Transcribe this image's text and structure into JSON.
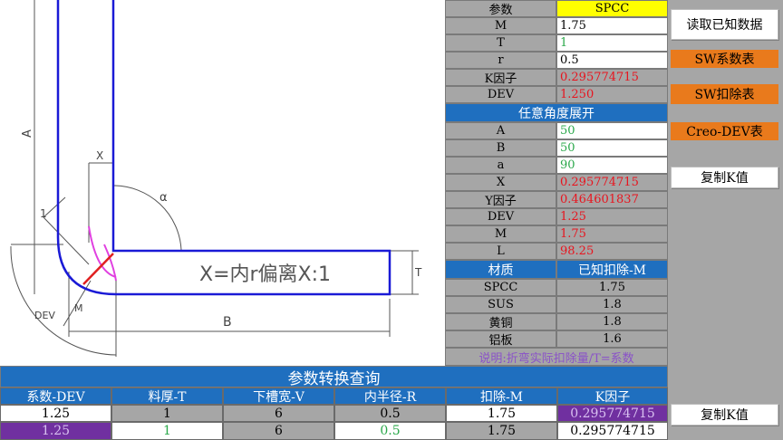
{
  "diagram": {
    "label_a": "A",
    "label_b": "B",
    "label_x": "X",
    "label_t": "T",
    "label_one": "1",
    "label_alpha": "α",
    "label_dev": "DEV",
    "label_m": "M",
    "formula": "X=内r偏离X:1"
  },
  "params": {
    "header_label": "参数",
    "header_value": "SPCC",
    "rows": [
      {
        "label": "M",
        "value": "1.75"
      },
      {
        "label": "T",
        "value": "1"
      },
      {
        "label": "r",
        "value": "0.5"
      },
      {
        "label": "K因子",
        "value": "0.295774715"
      },
      {
        "label": "DEV",
        "value": "1.250"
      }
    ]
  },
  "angle": {
    "title": "任意角度展开",
    "rows": [
      {
        "label": "A",
        "value": "50"
      },
      {
        "label": "B",
        "value": "50"
      },
      {
        "label": "a",
        "value": "90"
      },
      {
        "label": "X",
        "value": "0.295774715"
      },
      {
        "label": "Y因子",
        "value": "0.464601837"
      },
      {
        "label": "DEV",
        "value": "1.25"
      },
      {
        "label": "M",
        "value": "1.75"
      },
      {
        "label": "L",
        "value": "98.25"
      }
    ]
  },
  "materials": {
    "header_label": "材质",
    "header_value": "已知扣除-M",
    "rows": [
      {
        "label": "SPCC",
        "value": "1.75"
      },
      {
        "label": "SUS",
        "value": "1.8"
      },
      {
        "label": "黄铜",
        "value": "1.8"
      },
      {
        "label": "铝板",
        "value": "1.6"
      }
    ],
    "note": "说明:折弯实际扣除量/T=系数"
  },
  "buttons": {
    "read_data": "读取已知数据",
    "sw_coeff": "SW系数表",
    "sw_deduct": "SW扣除表",
    "creo_dev": "Creo-DEV表",
    "copy_k_top": "复制K值",
    "copy_k_bottom": "复制K值"
  },
  "convert": {
    "title": "参数转换查询",
    "headers": [
      "系数-DEV",
      "料厚-T",
      "下槽宽-V",
      "内半径-R",
      "扣除-M",
      "K因子"
    ],
    "row1": [
      "1.25",
      "1",
      "6",
      "0.5",
      "1.75",
      "0.295774715"
    ],
    "row2": [
      "1.25",
      "1",
      "6",
      "0.5",
      "1.75",
      "0.295774715"
    ]
  },
  "colors": {
    "header_yellow": "#ffff00",
    "blue": "#1f6fbf",
    "label_gray": "#a6a6a6",
    "value_red": "#e8141e",
    "value_green": "#2aa84a",
    "highlight_purple": "#7030a0",
    "button_orange": "#e97a1c"
  }
}
